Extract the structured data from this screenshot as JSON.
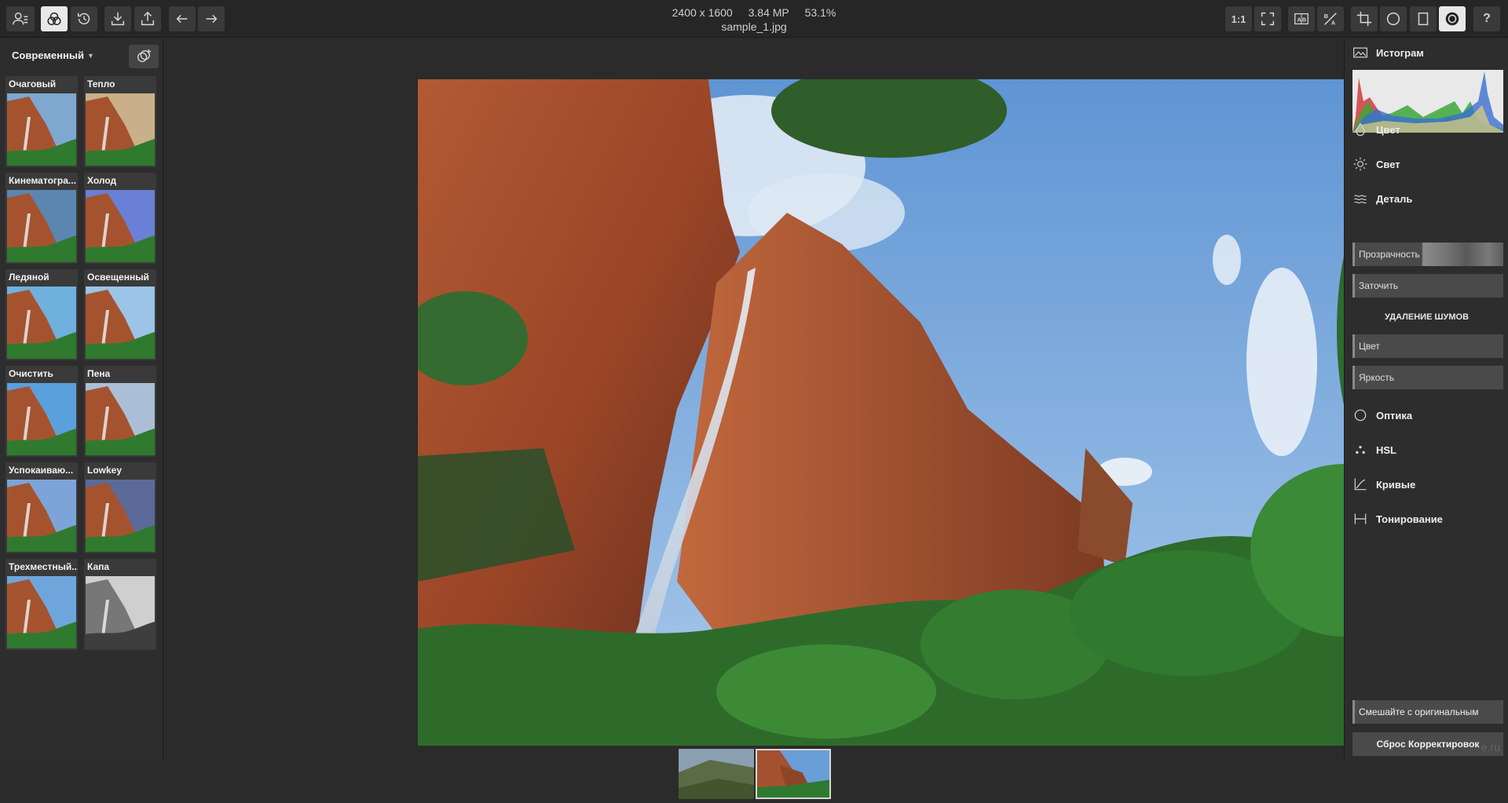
{
  "image_info": {
    "dimensions": "2400 x 1600",
    "megapixels": "3.84 MP",
    "zoom": "53.1%",
    "filename": "sample_1.jpg"
  },
  "toolbar": {
    "zoom_1to1": "1:1"
  },
  "left_panel": {
    "preset_category": "Современный",
    "presets": [
      {
        "name": "Очаговый",
        "tint": "#7fa8d0"
      },
      {
        "name": "Тепло",
        "tint": "#c9b08a"
      },
      {
        "name": "Кинематогра...",
        "tint": "#5b86b0"
      },
      {
        "name": "Холод",
        "tint": "#6a7fd6"
      },
      {
        "name": "Ледяной",
        "tint": "#6fb0dd"
      },
      {
        "name": "Освещенный",
        "tint": "#9cc4e6"
      },
      {
        "name": "Очистить",
        "tint": "#5aa0dc"
      },
      {
        "name": "Пена",
        "tint": "#aabfd6"
      },
      {
        "name": "Успокаиваю...",
        "tint": "#7ca4d8"
      },
      {
        "name": "Lowkey",
        "tint": "#5c6a99"
      },
      {
        "name": "Трехместный...",
        "tint": "#6ea6dc"
      },
      {
        "name": "Капа",
        "tint": "#cfcfcf"
      }
    ]
  },
  "right_panel": {
    "histogram": "Истограм",
    "color": "Цвет",
    "light": "Свет",
    "detail": "Деталь",
    "clarity": "Прозрачность",
    "sharpen": "Заточить",
    "noise_heading": "УДАЛЕНИЕ ШУМОВ",
    "noise_color": "Цвет",
    "noise_luma": "Яркость",
    "optics": "Оптика",
    "hsl": "HSL",
    "curves": "Кривые",
    "toning": "Тонирование",
    "blend": "Смешайте с оригинальным",
    "reset": "Сброс Корректировок"
  },
  "watermark": "e.ru"
}
